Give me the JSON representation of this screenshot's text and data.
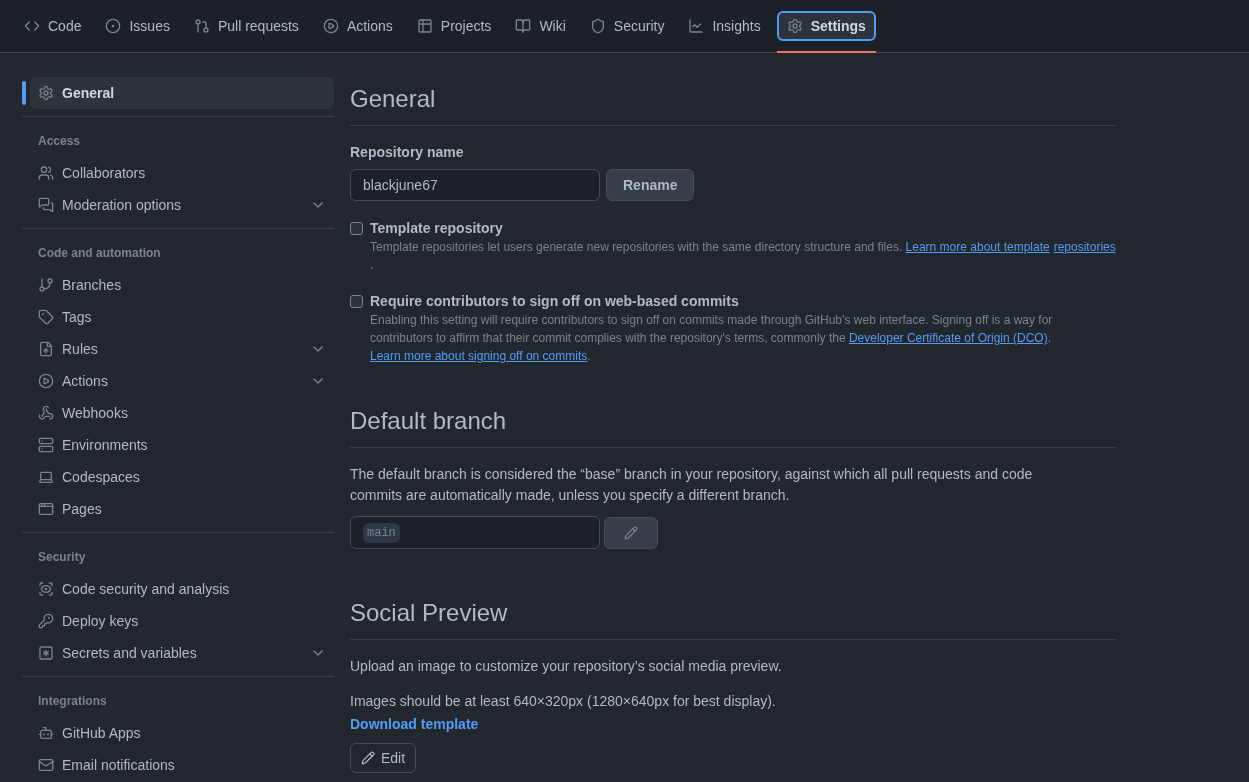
{
  "tabs": [
    {
      "label": "Code",
      "selected": false
    },
    {
      "label": "Issues",
      "selected": false
    },
    {
      "label": "Pull requests",
      "selected": false
    },
    {
      "label": "Actions",
      "selected": false
    },
    {
      "label": "Projects",
      "selected": false
    },
    {
      "label": "Wiki",
      "selected": false
    },
    {
      "label": "Security",
      "selected": false
    },
    {
      "label": "Insights",
      "selected": false
    },
    {
      "label": "Settings",
      "selected": true
    }
  ],
  "sidebar": {
    "groups": [
      {
        "items": [
          {
            "label": "General",
            "selected": true,
            "collapsible": false
          }
        ]
      },
      {
        "heading": "Access",
        "items": [
          {
            "label": "Collaborators",
            "selected": false,
            "collapsible": false
          },
          {
            "label": "Moderation options",
            "selected": false,
            "collapsible": true
          }
        ]
      },
      {
        "heading": "Code and automation",
        "items": [
          {
            "label": "Branches",
            "selected": false,
            "collapsible": false
          },
          {
            "label": "Tags",
            "selected": false,
            "collapsible": false
          },
          {
            "label": "Rules",
            "selected": false,
            "collapsible": true
          },
          {
            "label": "Actions",
            "selected": false,
            "collapsible": true
          },
          {
            "label": "Webhooks",
            "selected": false,
            "collapsible": false
          },
          {
            "label": "Environments",
            "selected": false,
            "collapsible": false
          },
          {
            "label": "Codespaces",
            "selected": false,
            "collapsible": false
          },
          {
            "label": "Pages",
            "selected": false,
            "collapsible": false
          }
        ]
      },
      {
        "heading": "Security",
        "items": [
          {
            "label": "Code security and analysis",
            "selected": false,
            "collapsible": false
          },
          {
            "label": "Deploy keys",
            "selected": false,
            "collapsible": false
          },
          {
            "label": "Secrets and variables",
            "selected": false,
            "collapsible": true
          }
        ]
      },
      {
        "heading": "Integrations",
        "items": [
          {
            "label": "GitHub Apps",
            "selected": false,
            "collapsible": false
          },
          {
            "label": "Email notifications",
            "selected": false,
            "collapsible": false
          }
        ]
      }
    ]
  },
  "general": {
    "title": "General",
    "repo_label": "Repository name",
    "repo_value": "blackjune67",
    "rename_button": "Rename",
    "options": [
      {
        "label": "Template repository",
        "checked": false,
        "description": [
          {
            "kind": "text",
            "text": "Template repositories let users generate new repositories with the same directory structure and files. "
          },
          {
            "kind": "link",
            "text": "Learn more about template"
          },
          {
            "kind": "link",
            "text": "repositories"
          },
          {
            "kind": "text",
            "text": "."
          }
        ]
      },
      {
        "label": "Require contributors to sign off on web-based commits",
        "checked": false,
        "description": [
          {
            "kind": "text",
            "text": "Enabling this setting will require contributors to sign off on commits made through GitHub’s web interface. Signing off is a way for contributors to affirm that their commit complies with the repository's terms, commonly the "
          },
          {
            "kind": "link",
            "text": "Developer Certificate of Origin (DCO)"
          },
          {
            "kind": "text",
            "text": ". "
          },
          {
            "kind": "link",
            "text": "Learn more about signing off on commits"
          },
          {
            "kind": "text",
            "text": "."
          }
        ]
      }
    ]
  },
  "default_branch": {
    "title": "Default branch",
    "description": "The default branch is considered the “base” branch in your repository, against which all pull requests and code commits are automatically made, unless you specify a different branch.",
    "branch": "main"
  },
  "social_preview": {
    "title": "Social Preview",
    "text_1": "Upload an image to customize your repository’s social media preview.",
    "text_2": "Images should be at least 640×320px (1280×640px for best display).",
    "download_link": "Download template",
    "edit_button": "Edit"
  }
}
